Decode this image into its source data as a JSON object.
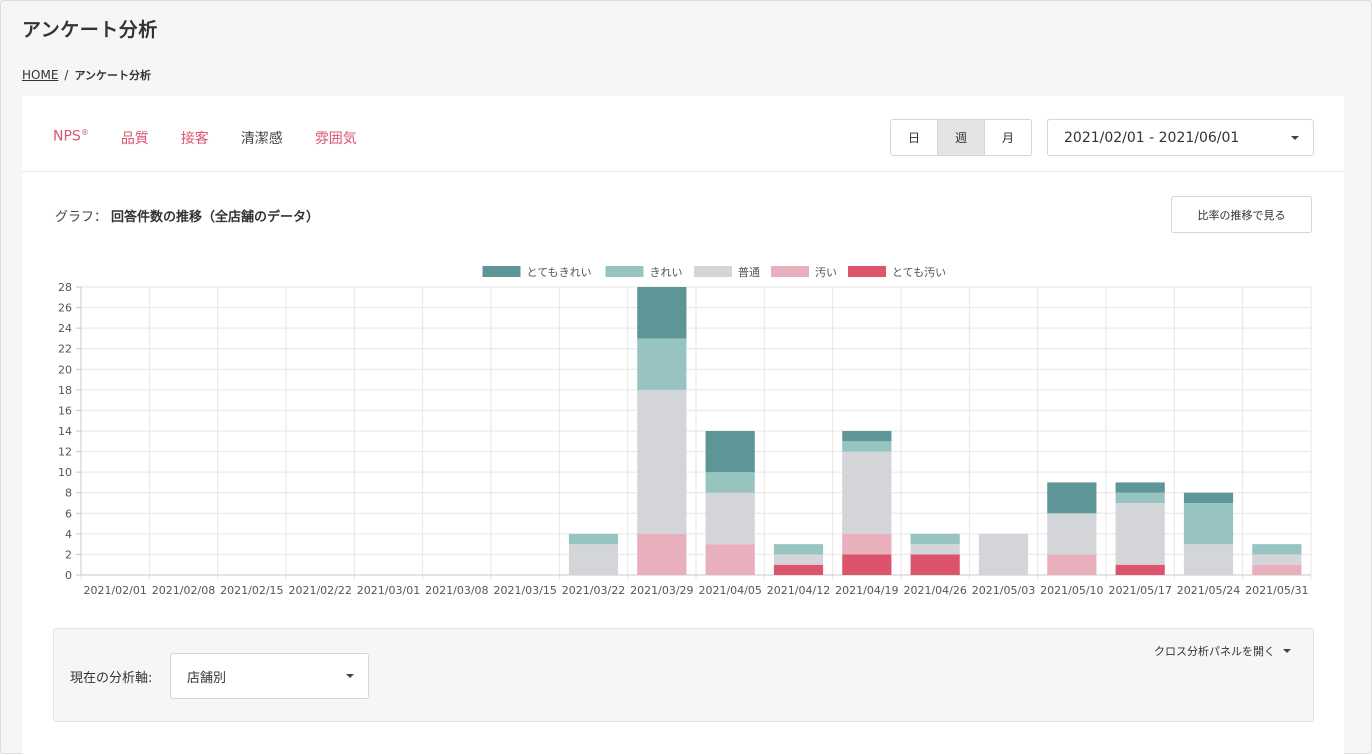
{
  "page": {
    "title": "アンケート分析"
  },
  "breadcrumb": {
    "home": "HOME",
    "current": "アンケート分析"
  },
  "metric_tabs": [
    {
      "label": "NPS",
      "sup": "®",
      "active": false
    },
    {
      "label": "品質",
      "active": false
    },
    {
      "label": "接客",
      "active": false
    },
    {
      "label": "清潔感",
      "active": true
    },
    {
      "label": "雰囲気",
      "active": false
    }
  ],
  "period": {
    "day": "日",
    "week": "週",
    "month": "月",
    "selected": "週"
  },
  "date_range": "2021/02/01 - 2021/06/01",
  "graph": {
    "prefix": "グラフ：",
    "title": "回答件数の推移（全店舗のデータ）"
  },
  "ratio_button": "比率の推移で見る",
  "colors": {
    "accent": "#d9566e",
    "series": [
      "#5e9698",
      "#97c3c1",
      "#d3d5d8",
      "#e8b0bd",
      "#dc546c"
    ]
  },
  "chart_data": {
    "type": "bar",
    "stacked": true,
    "categories": [
      "2021/02/01",
      "2021/02/08",
      "2021/02/15",
      "2021/02/22",
      "2021/03/01",
      "2021/03/08",
      "2021/03/15",
      "2021/03/22",
      "2021/03/29",
      "2021/04/05",
      "2021/04/12",
      "2021/04/19",
      "2021/04/26",
      "2021/05/03",
      "2021/05/10",
      "2021/05/17",
      "2021/05/24",
      "2021/05/31"
    ],
    "series": [
      {
        "name": "とても汚い",
        "values": [
          0,
          0,
          0,
          0,
          0,
          0,
          0,
          0,
          0,
          0,
          1,
          2,
          2,
          0,
          0,
          1,
          0,
          0
        ]
      },
      {
        "name": "汚い",
        "values": [
          0,
          0,
          0,
          0,
          0,
          0,
          0,
          0,
          4,
          3,
          0,
          2,
          0,
          0,
          2,
          0,
          0,
          1
        ]
      },
      {
        "name": "普通",
        "values": [
          0,
          0,
          0,
          0,
          0,
          0,
          0,
          3,
          14,
          5,
          1,
          8,
          1,
          4,
          4,
          6,
          3,
          1
        ]
      },
      {
        "name": "きれい",
        "values": [
          0,
          0,
          0,
          0,
          0,
          0,
          0,
          1,
          5,
          2,
          1,
          1,
          1,
          0,
          0,
          1,
          4,
          1
        ]
      },
      {
        "name": "とてもきれい",
        "values": [
          0,
          0,
          0,
          0,
          0,
          0,
          0,
          0,
          5,
          4,
          0,
          1,
          0,
          0,
          3,
          1,
          1,
          0
        ]
      }
    ],
    "legend_order": [
      "とてもきれい",
      "きれい",
      "普通",
      "汚い",
      "とても汚い"
    ],
    "ylim": [
      0,
      28
    ],
    "yticks": [
      0,
      2,
      4,
      6,
      8,
      10,
      12,
      14,
      16,
      18,
      20,
      22,
      24,
      26,
      28
    ],
    "grid": true,
    "legend_position": "top"
  },
  "filter": {
    "axis_label": "現在の分析軸:",
    "axis_value": "店舗別",
    "cross_panel": "クロス分析パネルを開く"
  }
}
